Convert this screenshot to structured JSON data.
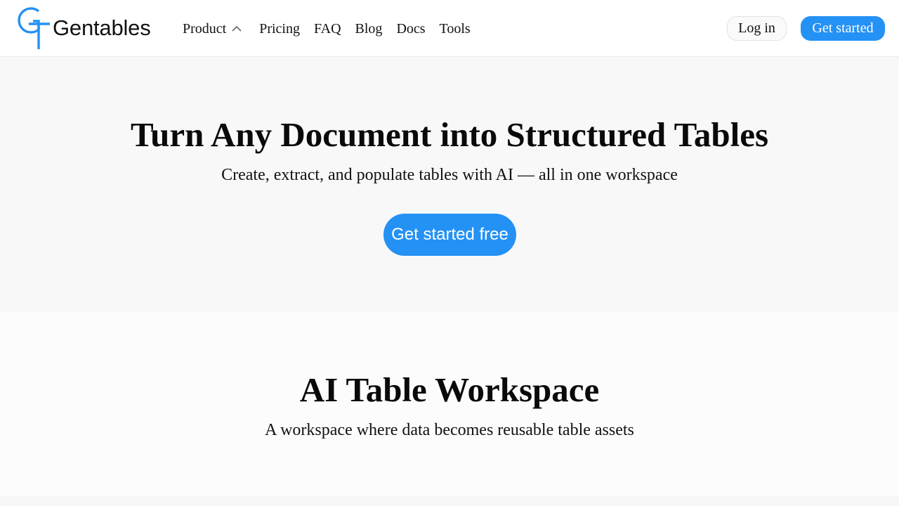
{
  "brand": {
    "name": "Gentables",
    "accent_color": "#2491f5",
    "logo_icon": "gt-monogram-icon"
  },
  "nav": {
    "items": [
      {
        "label": "Product",
        "icon": "chevron-up-icon"
      },
      {
        "label": "Pricing"
      },
      {
        "label": "FAQ"
      },
      {
        "label": "Blog"
      },
      {
        "label": "Docs"
      },
      {
        "label": "Tools"
      }
    ]
  },
  "header": {
    "login_label": "Log in",
    "get_started_label": "Get started"
  },
  "hero": {
    "title": "Turn Any Document into Structured Tables",
    "subtitle": "Create, extract, and populate tables with AI — all in one workspace",
    "cta_label": "Get started free"
  },
  "workspace_section": {
    "title": "AI Table Workspace",
    "subtitle": "A workspace where data becomes reusable table assets"
  }
}
